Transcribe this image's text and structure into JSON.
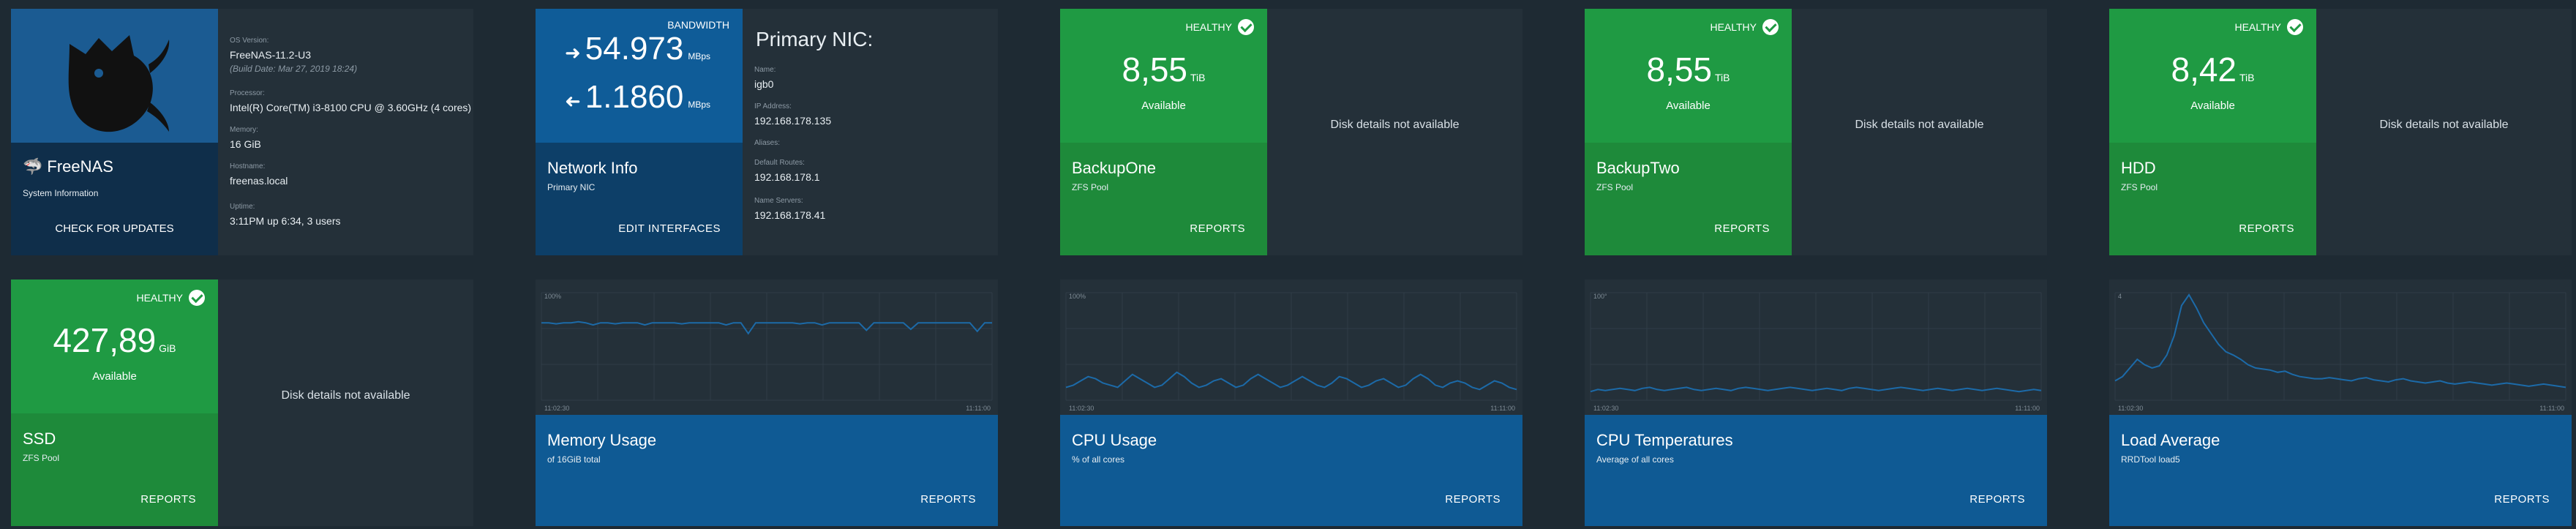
{
  "system": {
    "logo_text": "FreeNAS",
    "subtitle": "System Information",
    "check_updates": "CHECK FOR UPDATES",
    "os_label": "OS Version:",
    "os_value": "FreeNAS-11.2-U3",
    "build_date": "(Build Date: Mar 27, 2019 18:24)",
    "processor_label": "Processor:",
    "processor_value": "Intel(R) Core(TM) i3-8100 CPU @ 3.60GHz (4 cores)",
    "memory_label": "Memory:",
    "memory_value": "16 GiB",
    "hostname_label": "Hostname:",
    "hostname_value": "freenas.local",
    "uptime_label": "Uptime:",
    "uptime_value": "3:11PM up 6:34, 3 users"
  },
  "network": {
    "bandwidth_label": "BANDWIDTH",
    "in_value": "54.973",
    "out_value": "1.1860",
    "unit": "MBps",
    "title": "Network Info",
    "subtitle": "Primary NIC",
    "link": "EDIT INTERFACES",
    "nic_title": "Primary NIC:",
    "name_label": "Name:",
    "name_value": "igb0",
    "ip_label": "IP Address:",
    "ip_value": "192.168.178.135",
    "aliases_label": "Aliases:",
    "aliases_value": "",
    "gateway_label": "Default Routes:",
    "gateway_value": "192.168.178.1",
    "dns_label": "Name Servers:",
    "dns_value": "192.168.178.41"
  },
  "pools": [
    {
      "status": "HEALTHY",
      "size": "8,55",
      "unit": "TiB",
      "available": "Available",
      "name": "BackupOne",
      "type": "ZFS Pool",
      "link": "REPORTS",
      "disk_msg": "Disk details not available"
    },
    {
      "status": "HEALTHY",
      "size": "8,55",
      "unit": "TiB",
      "available": "Available",
      "name": "BackupTwo",
      "type": "ZFS Pool",
      "link": "REPORTS",
      "disk_msg": "Disk details not available"
    },
    {
      "status": "HEALTHY",
      "size": "8,42",
      "unit": "TiB",
      "available": "Available",
      "name": "HDD",
      "type": "ZFS Pool",
      "link": "REPORTS",
      "disk_msg": "Disk details not available"
    },
    {
      "status": "HEALTHY",
      "size": "427,89",
      "unit": "GiB",
      "available": "Available",
      "name": "SSD",
      "type": "ZFS Pool",
      "link": "REPORTS",
      "disk_msg": "Disk details not available"
    }
  ],
  "charts": [
    {
      "title": "Memory Usage",
      "subtitle": "of 16GiB total",
      "link": "REPORTS",
      "x_start": "11:02:30",
      "x_end": "11:11:00",
      "y_top": "100%"
    },
    {
      "title": "CPU Usage",
      "subtitle": "% of all cores",
      "link": "REPORTS",
      "x_start": "11:02:30",
      "x_end": "11:11:00",
      "y_top": "100%"
    },
    {
      "title": "CPU Temperatures",
      "subtitle": "Average of all cores",
      "link": "REPORTS",
      "x_start": "11:02:30",
      "x_end": "11:11:00",
      "y_top": "100°"
    },
    {
      "title": "Load Average",
      "subtitle": "RRDTool load5",
      "link": "REPORTS",
      "x_start": "11:02:30",
      "x_end": "11:11:00",
      "y_top": "4"
    }
  ],
  "chart_data": [
    {
      "type": "line",
      "title": "Memory Usage",
      "values": [
        0.72,
        0.72,
        0.71,
        0.72,
        0.72,
        0.73,
        0.72,
        0.7,
        0.72,
        0.72,
        0.71,
        0.72,
        0.72,
        0.72,
        0.7,
        0.72,
        0.72,
        0.72,
        0.72,
        0.71,
        0.72,
        0.72,
        0.72,
        0.72,
        0.72,
        0.7,
        0.72,
        0.72,
        0.62,
        0.72,
        0.72,
        0.72,
        0.72,
        0.72,
        0.72,
        0.71,
        0.72,
        0.72,
        0.7,
        0.72,
        0.72,
        0.72,
        0.72,
        0.72,
        0.65,
        0.72,
        0.72,
        0.72,
        0.72,
        0.72,
        0.66,
        0.72,
        0.72,
        0.72,
        0.72,
        0.72,
        0.72,
        0.72,
        0.72,
        0.64,
        0.72,
        0.72
      ]
    },
    {
      "type": "line",
      "title": "CPU Usage",
      "values": [
        0.12,
        0.14,
        0.18,
        0.22,
        0.2,
        0.16,
        0.14,
        0.12,
        0.18,
        0.24,
        0.2,
        0.16,
        0.12,
        0.14,
        0.2,
        0.26,
        0.22,
        0.16,
        0.12,
        0.14,
        0.18,
        0.2,
        0.16,
        0.12,
        0.14,
        0.2,
        0.24,
        0.2,
        0.16,
        0.12,
        0.14,
        0.18,
        0.22,
        0.18,
        0.14,
        0.12,
        0.16,
        0.22,
        0.2,
        0.16,
        0.12,
        0.14,
        0.18,
        0.2,
        0.16,
        0.12,
        0.14,
        0.2,
        0.24,
        0.2,
        0.14,
        0.12,
        0.16,
        0.18,
        0.16,
        0.12,
        0.1,
        0.14,
        0.18,
        0.16,
        0.12,
        0.1
      ]
    },
    {
      "type": "line",
      "title": "CPU Temperatures",
      "values": [
        0.08,
        0.1,
        0.09,
        0.1,
        0.11,
        0.1,
        0.09,
        0.11,
        0.12,
        0.1,
        0.09,
        0.1,
        0.11,
        0.12,
        0.1,
        0.09,
        0.1,
        0.11,
        0.1,
        0.09,
        0.11,
        0.12,
        0.11,
        0.1,
        0.09,
        0.1,
        0.11,
        0.12,
        0.11,
        0.1,
        0.09,
        0.1,
        0.11,
        0.1,
        0.09,
        0.11,
        0.12,
        0.11,
        0.1,
        0.09,
        0.1,
        0.11,
        0.12,
        0.11,
        0.1,
        0.09,
        0.1,
        0.11,
        0.1,
        0.09,
        0.1,
        0.11,
        0.1,
        0.09,
        0.1,
        0.11,
        0.1,
        0.09,
        0.08,
        0.09,
        0.1,
        0.09
      ]
    },
    {
      "type": "line",
      "title": "Load Average",
      "values": [
        0.18,
        0.22,
        0.3,
        0.38,
        0.33,
        0.3,
        0.32,
        0.42,
        0.6,
        0.88,
        0.98,
        0.86,
        0.72,
        0.62,
        0.52,
        0.45,
        0.42,
        0.38,
        0.33,
        0.3,
        0.29,
        0.28,
        0.26,
        0.27,
        0.24,
        0.22,
        0.21,
        0.2,
        0.2,
        0.21,
        0.2,
        0.19,
        0.18,
        0.2,
        0.21,
        0.19,
        0.18,
        0.17,
        0.19,
        0.2,
        0.18,
        0.17,
        0.16,
        0.17,
        0.18,
        0.16,
        0.15,
        0.16,
        0.17,
        0.16,
        0.15,
        0.14,
        0.15,
        0.16,
        0.15,
        0.14,
        0.13,
        0.14,
        0.15,
        0.14,
        0.13,
        0.12
      ]
    }
  ]
}
